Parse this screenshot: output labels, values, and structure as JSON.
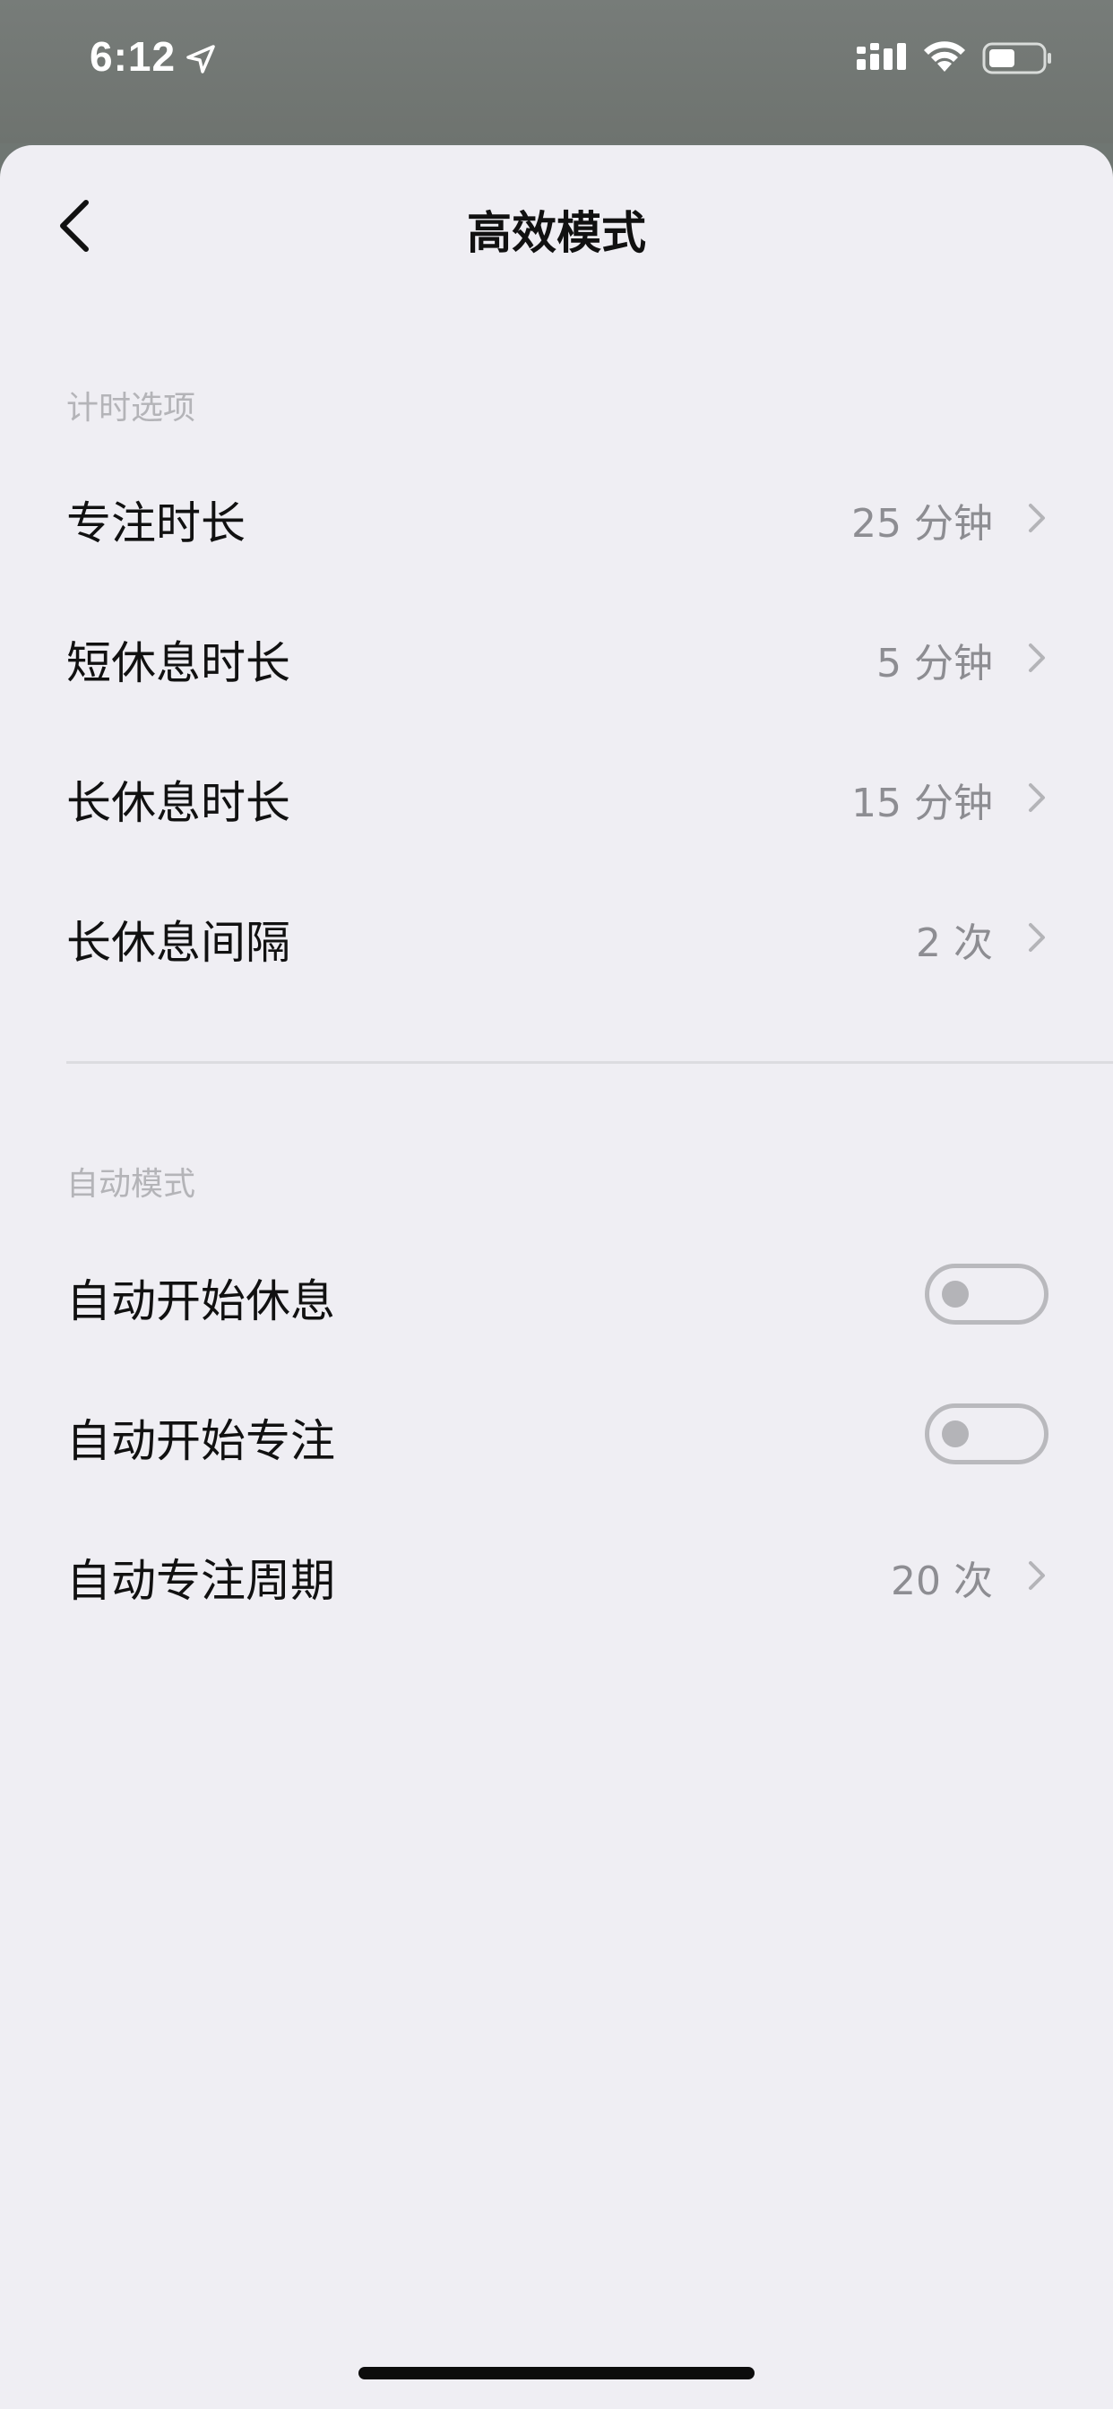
{
  "status_bar": {
    "time": "6:12"
  },
  "nav": {
    "title": "高效模式"
  },
  "sections": {
    "timer": {
      "header": "计时选项",
      "rows": [
        {
          "label": "专注时长",
          "value": "25 分钟"
        },
        {
          "label": "短休息时长",
          "value": "5 分钟"
        },
        {
          "label": "长休息时长",
          "value": "15 分钟"
        },
        {
          "label": "长休息间隔",
          "value": "2 次"
        }
      ]
    },
    "auto": {
      "header": "自动模式",
      "toggles": [
        {
          "label": "自动开始休息",
          "on": false
        },
        {
          "label": "自动开始专注",
          "on": false
        }
      ],
      "cycle": {
        "label": "自动专注周期",
        "value": "20 次"
      }
    }
  },
  "colors": {
    "background": "#efeef3",
    "status_bar": "#747975",
    "secondary_text": "#8d8d92",
    "section_header": "#b4b4b8"
  }
}
